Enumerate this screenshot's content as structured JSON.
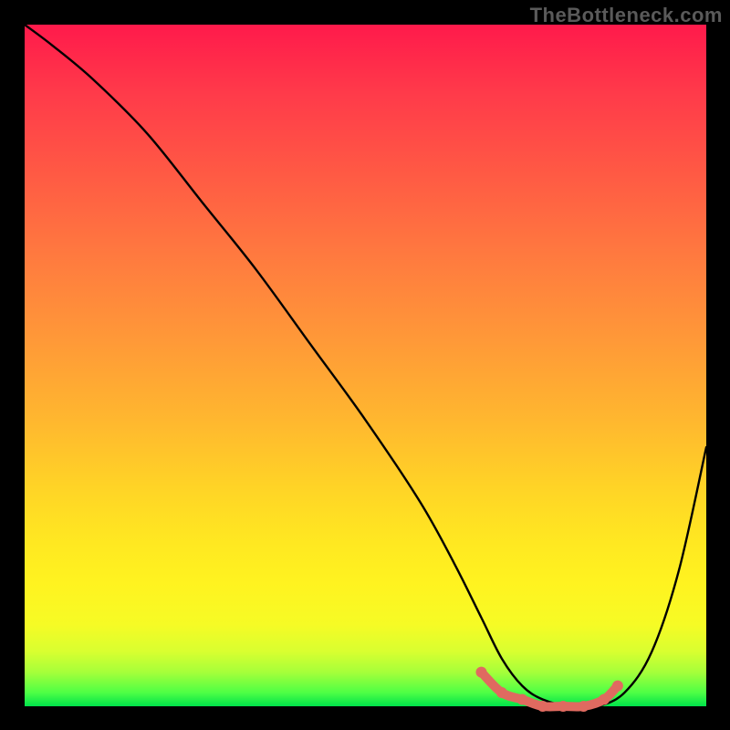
{
  "watermark": "TheBottleneck.com",
  "chart_data": {
    "type": "line",
    "title": "",
    "xlabel": "",
    "ylabel": "",
    "xlim": [
      0,
      100
    ],
    "ylim": [
      0,
      100
    ],
    "series": [
      {
        "name": "bottleneck-curve",
        "x": [
          0,
          4,
          10,
          18,
          26,
          34,
          42,
          50,
          58,
          63,
          67,
          70,
          73,
          76,
          80,
          84,
          88,
          92,
          96,
          100
        ],
        "y": [
          100,
          97,
          92,
          84,
          74,
          64,
          53,
          42,
          30,
          21,
          13,
          7,
          3,
          1,
          0,
          0,
          2,
          8,
          20,
          38
        ]
      }
    ],
    "flat_region": {
      "name": "optimal-range",
      "x": [
        67,
        70,
        73,
        76,
        79,
        82,
        85,
        87
      ],
      "y": [
        5,
        2,
        1,
        0,
        0,
        0,
        1,
        3
      ]
    },
    "colors": {
      "curve": "#000000",
      "flat_marker": "#e06a60"
    }
  }
}
